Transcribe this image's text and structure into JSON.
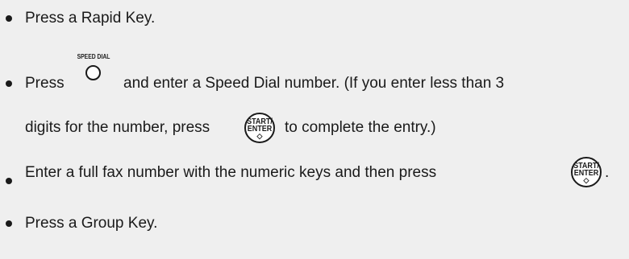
{
  "items": [
    {
      "text": "Press a Rapid Key."
    },
    {
      "text_before_key": "Press",
      "speed_dial_key_label": "SPEED DIAL",
      "text_after_key": "and enter a Speed Dial number. (If you enter less than 3",
      "continuation_before_key": "digits for the number, press",
      "continuation_after_key": "to complete the entry.)"
    },
    {
      "text_before_key": "Enter a full fax number with the numeric keys and then press",
      "text_after_key": "."
    },
    {
      "text": "Press a Group Key."
    }
  ],
  "start_enter_key": {
    "line1": "START/",
    "line2": "ENTER",
    "symbol": "◇"
  },
  "colors": {
    "background": "#efefef",
    "text": "#1a1a1a"
  }
}
